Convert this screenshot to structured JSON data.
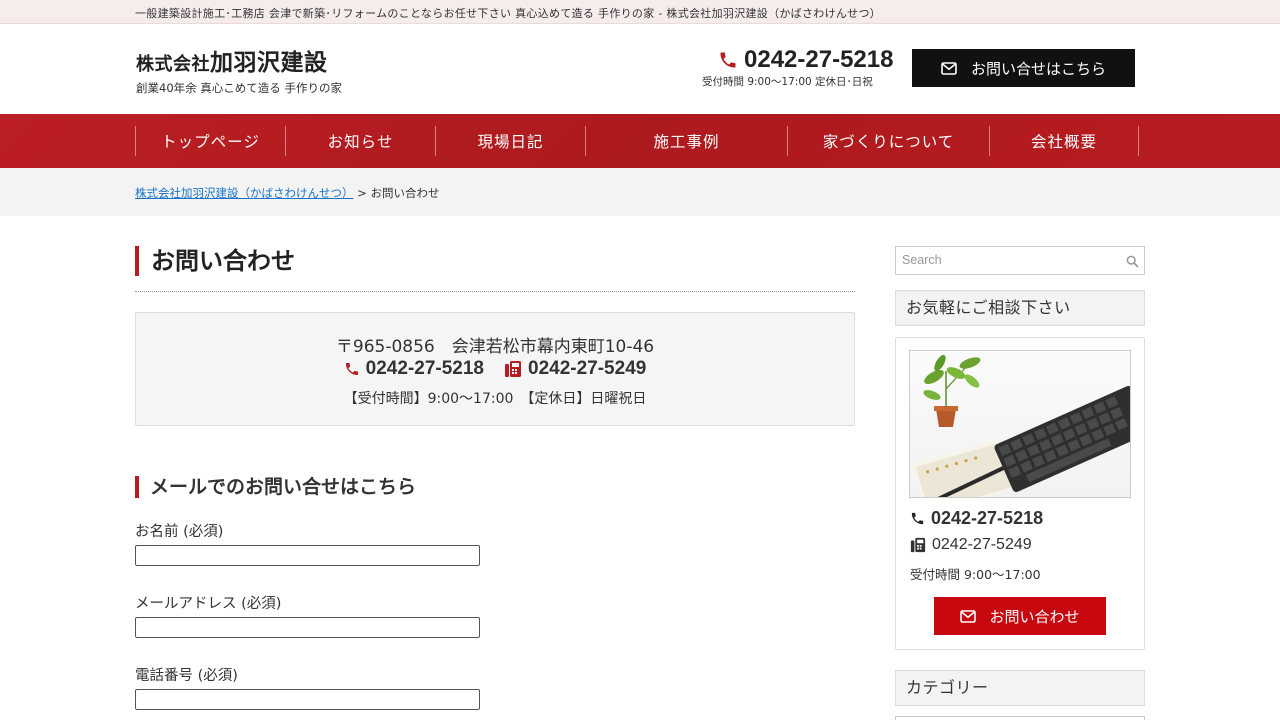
{
  "topbar": {
    "text": "一般建築設計施工･工務店 会津で新築･リフォームのことならお任せ下さい 真心込めて造る 手作りの家 - 株式会社加羽沢建設（かばさわけんせつ）"
  },
  "header": {
    "company_prefix": "株式会社",
    "company_name": "加羽沢建設",
    "tagline": "創業40年余 真心こめて造る 手作りの家",
    "phone": "0242-27-5218",
    "hours": "受付時間 9:00～17:00 定休日･日祝",
    "contact_button": "お問い合せはこちら"
  },
  "nav": {
    "items": [
      {
        "label": "トップページ"
      },
      {
        "label": "お知らせ"
      },
      {
        "label": "現場日記"
      },
      {
        "label": "施工事例"
      },
      {
        "label": "家づくりについて"
      },
      {
        "label": "会社概要"
      }
    ]
  },
  "breadcrumb": {
    "home": "株式会社加羽沢建設（かばさわけんせつ）",
    "separator": ">",
    "current": "お問い合わせ"
  },
  "main": {
    "page_title": "お問い合わせ",
    "info": {
      "address": "〒965-0856　会津若松市幕内東町10-46",
      "phone": "0242-27-5218",
      "fax": "0242-27-5249",
      "hours": "【受付時間】9:00～17:00　【定休日】日曜祝日"
    },
    "section_title": "メールでのお問い合せはこちら",
    "form": {
      "name_label": "お名前 (必須)",
      "email_label": "メールアドレス (必須)",
      "phone_label": "電話番号 (必須)"
    }
  },
  "sidebar": {
    "search_placeholder": "Search",
    "consult_heading": "お気軽にご相談下さい",
    "phone": "0242-27-5218",
    "fax": "0242-27-5249",
    "hours": "受付時間 9:00～17:00",
    "contact_button": "お問い合わせ",
    "category_heading": "カテゴリー"
  },
  "colors": {
    "brand_red": "#b71c20",
    "button_red": "#c8080f",
    "button_black": "#111111",
    "link_blue": "#1a73c9"
  },
  "icons": [
    "phone-icon",
    "fax-icon",
    "envelope-icon",
    "search-icon"
  ]
}
